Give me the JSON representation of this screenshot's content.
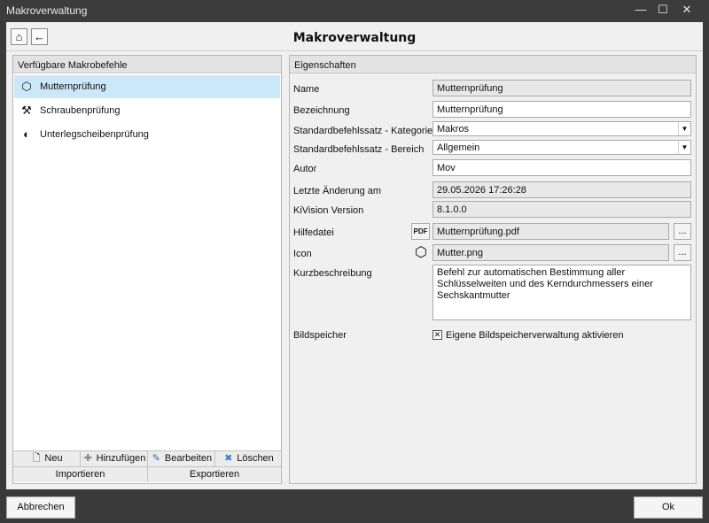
{
  "window": {
    "title": "Makroverwaltung",
    "minimize_glyph": "—",
    "maximize_glyph": "☐",
    "close_glyph": "✕"
  },
  "header": {
    "title": "Makroverwaltung",
    "home_glyph": "⌂",
    "back_glyph": "←"
  },
  "left": {
    "title": "Verfügbare Makrobefehle",
    "items": [
      {
        "label": "Mutternprüfung",
        "icon": "hex-nut-icon",
        "glyph": "⬡",
        "selected": true
      },
      {
        "label": "Schraubenprüfung",
        "icon": "screw-icon",
        "glyph": "⚒",
        "selected": false
      },
      {
        "label": "Unterlegscheibenprüfung",
        "icon": "washer-icon",
        "glyph": "◐",
        "selected": false
      }
    ],
    "buttons": {
      "new": "Neu",
      "add": "Hinzufügen",
      "edit": "Bearbeiten",
      "delete": "Löschen",
      "import": "Importieren",
      "export": "Exportieren",
      "new_glyph": "🗋",
      "add_glyph": "✚",
      "edit_glyph": "✎",
      "delete_glyph": "✖"
    }
  },
  "right": {
    "title": "Eigenschaften",
    "name_label": "Name",
    "name_value": "Mutternprüfung",
    "designation_label": "Bezeichnung",
    "designation_value": "Mutternprüfung",
    "category_label": "Standardbefehlssatz - Kategorie",
    "category_value": "Makros",
    "area_label": "Standardbefehlssatz - Bereich",
    "area_value": "Allgemein",
    "author_label": "Autor",
    "author_value": "Mov",
    "changed_label": "Letzte Änderung am",
    "changed_value": "29.05.2026 17:26:28",
    "version_label": "KiVision Version",
    "version_value": "8.1.0.0",
    "help_label": "Hilfedatei",
    "help_icon_text": "PDF",
    "help_value": "Mutternprüfung.pdf",
    "icon_label": "Icon",
    "icon_value": "Mutter.png",
    "browse_text": "...",
    "desc_label": "Kurzbeschreibung",
    "desc_value": "Befehl zur automatischen Bestimmung aller Schlüsselweiten und des Kerndurchmessers einer Sechskantmutter",
    "imagestore_label": "Bildspeicher",
    "imagestore_check": "✕",
    "imagestore_option": "Eigene Bildspeicherverwaltung aktivieren",
    "dropdown_glyph": "▼"
  },
  "footer": {
    "cancel": "Abbrechen",
    "ok": "Ok"
  }
}
